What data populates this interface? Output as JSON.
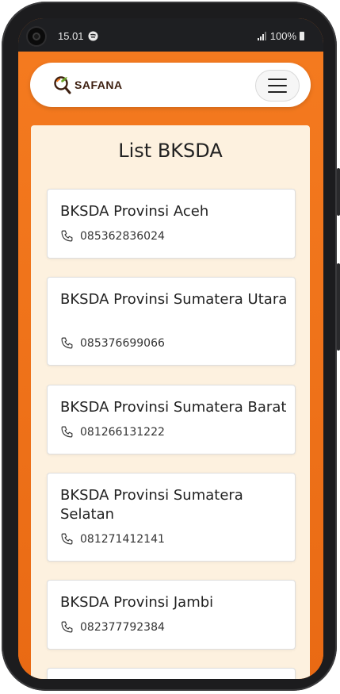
{
  "status": {
    "time": "15.01",
    "battery": "100%"
  },
  "brand": {
    "name": "SAFANA"
  },
  "page": {
    "title": "List BKSDA"
  },
  "contacts": [
    {
      "name": "BKSDA Provinsi Aceh",
      "phone": "085362836024"
    },
    {
      "name": "BKSDA Provinsi Sumatera Utara",
      "phone": "085376699066"
    },
    {
      "name": "BKSDA Provinsi Sumatera Barat",
      "phone": "081266131222"
    },
    {
      "name": "BKSDA Provinsi Sumatera Selatan",
      "phone": "081271412141"
    },
    {
      "name": "BKSDA Provinsi Jambi",
      "phone": "082377792384"
    }
  ],
  "colors": {
    "accent": "#f47a1f",
    "panel": "#fdf1df"
  },
  "icons": {
    "phone": "phone-icon",
    "menu": "hamburger-menu-icon",
    "logo": "magnifier-leaf-icon"
  }
}
